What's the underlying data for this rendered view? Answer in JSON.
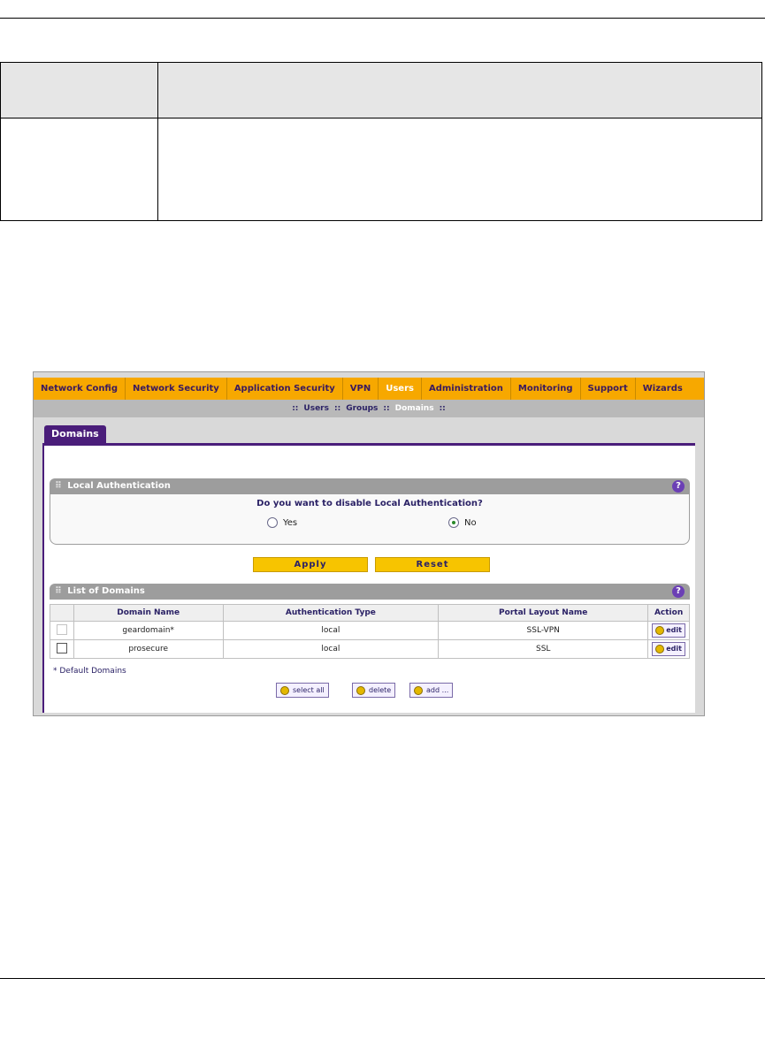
{
  "nav": {
    "items": [
      "Network Config",
      "Network Security",
      "Application Security",
      "VPN",
      "Users",
      "Administration",
      "Monitoring",
      "Support",
      "Wizards"
    ],
    "active": "Users"
  },
  "subnav": {
    "items": [
      "Users",
      "Groups",
      "Domains"
    ],
    "active": "Domains",
    "separator": "::"
  },
  "tab": {
    "label": "Domains"
  },
  "local_auth": {
    "title": "Local Authentication",
    "question": "Do you want to disable Local Authentication?",
    "options": [
      "Yes",
      "No"
    ],
    "selected": "No",
    "help": "?"
  },
  "buttons": {
    "apply": "Apply",
    "reset": "Reset"
  },
  "domains": {
    "title": "List of Domains",
    "help": "?",
    "columns": [
      "Domain Name",
      "Authentication Type",
      "Portal Layout Name",
      "Action"
    ],
    "rows": [
      {
        "name": "geardomain*",
        "auth": "local",
        "portal": "SSL-VPN",
        "action": "edit"
      },
      {
        "name": "prosecure",
        "auth": "local",
        "portal": "SSL",
        "action": "edit"
      }
    ],
    "note": "* Default Domains",
    "select_all": "select all",
    "delete": "delete",
    "add": "add ..."
  }
}
